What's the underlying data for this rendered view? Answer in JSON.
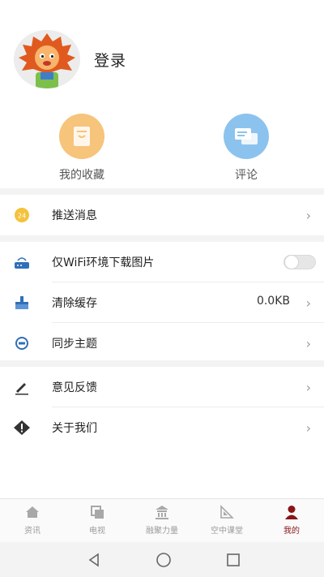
{
  "profile": {
    "login_label": "登录"
  },
  "quick_actions": {
    "favorites_label": "我的收藏",
    "comments_label": "评论"
  },
  "settings": {
    "push": {
      "label": "推送消息",
      "badge": "24"
    },
    "wifi_images": {
      "label": "仅WiFi环境下载图片",
      "enabled": false
    },
    "clear_cache": {
      "label": "清除缓存",
      "value": "0.0KB"
    },
    "sync_theme": {
      "label": "同步主题"
    },
    "feedback": {
      "label": "意见反馈"
    },
    "about": {
      "label": "关于我们"
    }
  },
  "tabbar": {
    "items": [
      {
        "label": "资讯",
        "icon": "home-icon"
      },
      {
        "label": "电视",
        "icon": "tv-icon"
      },
      {
        "label": "融聚力量",
        "icon": "temple-icon"
      },
      {
        "label": "空中课堂",
        "icon": "classroom-icon"
      },
      {
        "label": "我的",
        "icon": "user-icon",
        "active": true
      }
    ]
  },
  "colors": {
    "accent": "#8a1518",
    "favorites_circle": "#f6c47a",
    "comments_circle": "#8cc3ee",
    "nav_blue": "#2f6fb8"
  }
}
